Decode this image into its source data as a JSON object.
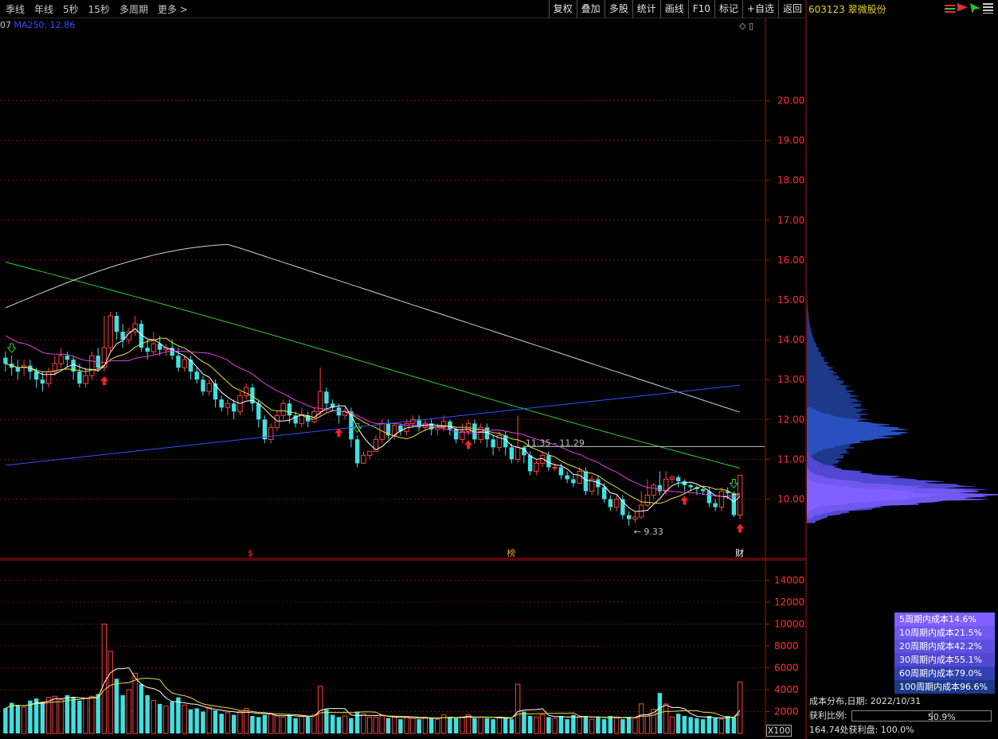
{
  "toolbar": {
    "left_items": [
      "季线",
      "年线",
      "5秒",
      "15秒",
      "多周期",
      "更多 >"
    ],
    "right_items": [
      "复权",
      "叠加",
      "多股",
      "统计",
      "画线",
      "F10",
      "标记",
      "+自选",
      "返回"
    ]
  },
  "stock": {
    "code_name": "603123 翠微股份"
  },
  "ma_label": {
    "prefix": "07",
    "text": "MA250: 12.86"
  },
  "corner_icons": "◇ ▯",
  "chart_data": [
    {
      "type": "candlestick",
      "title": "",
      "ylim": [
        9.0,
        21.2
      ],
      "y_ticks": [
        10.0,
        11.0,
        12.0,
        13.0,
        14.0,
        15.0,
        16.0,
        17.0,
        18.0,
        19.0,
        20.0
      ],
      "y_tick_labels": [
        "10.00",
        "11.00",
        "12.00",
        "13.00",
        "14.00",
        "15.00",
        "16.00",
        "17.00",
        "18.00",
        "19.00",
        "20.00"
      ],
      "grid": true,
      "annotations": [
        {
          "text": "11.35 - 11.29",
          "value": 11.32
        },
        {
          "text": "9.33",
          "value": 9.33
        }
      ],
      "markers": [
        {
          "text": "$",
          "color": "#ff3030"
        },
        {
          "text": "榜",
          "color": "#e0a020"
        },
        {
          "text": "财",
          "color": "#ffffff"
        }
      ],
      "candles": [
        [
          13.55,
          13.4,
          13.7,
          13.2
        ],
        [
          13.4,
          13.3,
          13.6,
          13.1
        ],
        [
          13.3,
          13.2,
          13.5,
          13.0
        ],
        [
          13.3,
          13.35,
          13.5,
          13.1
        ],
        [
          13.35,
          13.2,
          13.5,
          13.0
        ],
        [
          13.2,
          13.0,
          13.3,
          12.8
        ],
        [
          13.0,
          12.9,
          13.2,
          12.7
        ],
        [
          12.9,
          13.2,
          13.3,
          12.8
        ],
        [
          13.2,
          13.4,
          13.6,
          13.1
        ],
        [
          13.4,
          13.6,
          13.8,
          13.3
        ],
        [
          13.6,
          13.5,
          13.7,
          13.3
        ],
        [
          13.5,
          13.2,
          13.6,
          13.0
        ],
        [
          13.2,
          12.9,
          13.4,
          12.8
        ],
        [
          12.9,
          13.1,
          13.3,
          12.8
        ],
        [
          13.1,
          13.6,
          13.7,
          13.0
        ],
        [
          13.6,
          13.3,
          13.8,
          13.2
        ],
        [
          13.3,
          13.8,
          14.6,
          13.2
        ],
        [
          13.8,
          14.6,
          14.7,
          13.7
        ],
        [
          14.6,
          14.2,
          14.7,
          14.0
        ],
        [
          14.2,
          14.0,
          14.4,
          13.8
        ],
        [
          14.0,
          14.2,
          14.3,
          13.9
        ],
        [
          14.2,
          14.4,
          14.6,
          14.1
        ],
        [
          14.4,
          13.8,
          14.5,
          13.7
        ],
        [
          13.8,
          13.7,
          14.0,
          13.5
        ],
        [
          13.7,
          13.9,
          14.2,
          13.6
        ],
        [
          13.9,
          13.75,
          14.1,
          13.6
        ],
        [
          13.75,
          13.8,
          13.9,
          13.6
        ],
        [
          13.8,
          13.6,
          14.0,
          13.5
        ],
        [
          13.6,
          13.3,
          13.8,
          13.2
        ],
        [
          13.3,
          13.5,
          13.6,
          13.2
        ],
        [
          13.5,
          13.2,
          13.6,
          13.0
        ],
        [
          13.2,
          13.0,
          13.3,
          12.9
        ],
        [
          13.0,
          12.7,
          13.1,
          12.6
        ],
        [
          12.7,
          12.9,
          13.0,
          12.6
        ],
        [
          12.9,
          12.5,
          13.0,
          12.3
        ],
        [
          12.5,
          12.3,
          12.6,
          12.2
        ],
        [
          12.3,
          12.4,
          12.5,
          12.1
        ],
        [
          12.4,
          12.2,
          12.5,
          12.0
        ],
        [
          12.2,
          12.6,
          12.7,
          12.1
        ],
        [
          12.6,
          12.8,
          12.9,
          12.5
        ],
        [
          12.8,
          12.4,
          12.9,
          12.2
        ],
        [
          12.4,
          12.0,
          12.5,
          11.8
        ],
        [
          12.0,
          11.5,
          12.1,
          11.4
        ],
        [
          11.5,
          11.8,
          11.9,
          11.4
        ],
        [
          11.8,
          12.1,
          12.2,
          11.7
        ],
        [
          12.1,
          12.4,
          12.5,
          12.0
        ],
        [
          12.4,
          12.1,
          12.5,
          11.9
        ],
        [
          12.1,
          11.9,
          12.2,
          11.8
        ],
        [
          11.9,
          12.1,
          12.3,
          11.8
        ],
        [
          12.1,
          11.95,
          12.2,
          11.8
        ],
        [
          11.95,
          12.2,
          12.3,
          11.9
        ],
        [
          12.2,
          12.7,
          13.3,
          12.1
        ],
        [
          12.7,
          12.4,
          12.8,
          12.2
        ],
        [
          12.4,
          12.3,
          12.5,
          12.2
        ],
        [
          12.3,
          12.1,
          12.4,
          11.9
        ],
        [
          12.1,
          12.2,
          12.3,
          12.0
        ],
        [
          12.2,
          11.5,
          12.3,
          11.3
        ],
        [
          11.5,
          10.9,
          11.6,
          10.8
        ],
        [
          10.9,
          11.1,
          11.2,
          10.9
        ],
        [
          11.1,
          11.2,
          11.2,
          11.0
        ],
        [
          11.2,
          11.5,
          11.6,
          11.2
        ],
        [
          11.5,
          11.9,
          12.0,
          11.4
        ],
        [
          11.9,
          11.6,
          12.0,
          11.5
        ],
        [
          11.6,
          11.85,
          11.9,
          11.5
        ],
        [
          11.85,
          11.7,
          11.9,
          11.6
        ],
        [
          11.7,
          11.9,
          12.0,
          11.6
        ],
        [
          11.9,
          12.0,
          12.1,
          11.8
        ],
        [
          12.0,
          11.8,
          12.1,
          11.7
        ],
        [
          11.8,
          11.9,
          12.0,
          11.7
        ],
        [
          11.9,
          11.75,
          12.0,
          11.6
        ],
        [
          11.75,
          11.8,
          11.9,
          11.6
        ],
        [
          11.8,
          11.95,
          12.1,
          11.7
        ],
        [
          11.95,
          11.75,
          12.0,
          11.6
        ],
        [
          11.75,
          11.5,
          11.8,
          11.4
        ],
        [
          11.5,
          11.7,
          11.9,
          11.4
        ],
        [
          11.7,
          11.9,
          12.0,
          11.6
        ],
        [
          11.9,
          11.5,
          12.0,
          11.4
        ],
        [
          11.5,
          11.8,
          11.9,
          11.4
        ],
        [
          11.8,
          11.5,
          11.9,
          11.3
        ],
        [
          11.5,
          11.3,
          11.6,
          11.1
        ],
        [
          11.3,
          11.6,
          11.7,
          11.2
        ],
        [
          11.6,
          11.3,
          11.7,
          11.1
        ],
        [
          11.3,
          11.0,
          11.4,
          10.9
        ],
        [
          11.0,
          11.3,
          12.1,
          10.9
        ],
        [
          11.3,
          11.1,
          11.35,
          10.9
        ],
        [
          11.1,
          10.7,
          11.2,
          10.6
        ],
        [
          10.7,
          10.9,
          11.0,
          10.6
        ],
        [
          10.9,
          11.1,
          11.2,
          10.8
        ],
        [
          11.1,
          10.8,
          11.2,
          10.7
        ],
        [
          10.8,
          10.8,
          10.9,
          10.7
        ],
        [
          10.8,
          10.6,
          10.9,
          10.5
        ],
        [
          10.6,
          10.5,
          10.7,
          10.4
        ],
        [
          10.5,
          10.4,
          10.6,
          10.3
        ],
        [
          10.4,
          10.7,
          10.8,
          10.4
        ],
        [
          10.7,
          10.2,
          10.8,
          10.1
        ],
        [
          10.2,
          10.5,
          10.6,
          10.1
        ],
        [
          10.5,
          10.3,
          10.6,
          10.1
        ],
        [
          10.3,
          10.0,
          10.4,
          9.9
        ],
        [
          10.0,
          9.8,
          10.1,
          9.7
        ],
        [
          9.8,
          10.0,
          10.1,
          9.7
        ],
        [
          10.0,
          9.6,
          10.1,
          9.5
        ],
        [
          9.6,
          9.5,
          9.7,
          9.33
        ],
        [
          9.5,
          9.55,
          9.7,
          9.4
        ],
        [
          9.55,
          9.85,
          10.2,
          9.5
        ],
        [
          9.85,
          10.1,
          10.5,
          9.8
        ],
        [
          10.1,
          10.35,
          10.4,
          10.0
        ],
        [
          10.35,
          10.2,
          10.7,
          10.1
        ],
        [
          10.2,
          10.5,
          10.7,
          10.1
        ],
        [
          10.5,
          10.55,
          10.6,
          10.4
        ],
        [
          10.55,
          10.45,
          10.6,
          10.3
        ],
        [
          10.45,
          10.35,
          10.5,
          10.2
        ],
        [
          10.35,
          10.3,
          10.4,
          10.2
        ],
        [
          10.3,
          10.25,
          10.35,
          10.1
        ],
        [
          10.25,
          10.2,
          10.3,
          10.1
        ],
        [
          10.2,
          9.9,
          10.3,
          9.8
        ],
        [
          9.9,
          9.8,
          10.0,
          9.7
        ],
        [
          9.8,
          10.2,
          10.3,
          9.7
        ],
        [
          10.2,
          10.15,
          10.3,
          10.0
        ],
        [
          10.15,
          9.6,
          10.2,
          9.55
        ],
        [
          9.6,
          10.6,
          10.6,
          9.5
        ]
      ],
      "ma_lines": [
        {
          "name": "MA5",
          "color": "#ffffff"
        },
        {
          "name": "MA10",
          "color": "#e8e040"
        },
        {
          "name": "MA20",
          "color": "#e040e0"
        },
        {
          "name": "MA60",
          "color": "#30d030"
        },
        {
          "name": "MA120",
          "color": "#d0d0d0"
        },
        {
          "name": "MA250",
          "color": "#3050ff"
        }
      ]
    },
    {
      "type": "bar",
      "title": "volume",
      "ylim": [
        0,
        15000
      ],
      "y_ticks": [
        2000,
        4000,
        6000,
        8000,
        10000,
        12000,
        14000
      ],
      "y_tick_labels": [
        "2000",
        "4000",
        "6000",
        "8000",
        "10000",
        "12000",
        "14000"
      ],
      "unit_label": "X100",
      "values": [
        2300,
        2800,
        2600,
        2400,
        3000,
        3200,
        2900,
        3300,
        3400,
        3100,
        3500,
        3300,
        3000,
        3200,
        3400,
        3600,
        10000,
        7500,
        5000,
        3500,
        4000,
        5500,
        4500,
        3500,
        3000,
        2700,
        2500,
        2900,
        3300,
        2600,
        2200,
        2300,
        2000,
        2400,
        2100,
        1800,
        1900,
        1700,
        2000,
        2300,
        1600,
        1500,
        1700,
        1800,
        1600,
        1500,
        1700,
        1400,
        1600,
        1500,
        1700,
        4300,
        2200,
        1700,
        1500,
        1600,
        1400,
        2000,
        1800,
        1500,
        1500,
        1600,
        1400,
        1500,
        1300,
        1500,
        1400,
        1300,
        1500,
        1400,
        1300,
        1700,
        1500,
        1400,
        1500,
        1700,
        1400,
        1500,
        1400,
        1300,
        1500,
        1400,
        1300,
        4500,
        2000,
        1600,
        1500,
        1700,
        1500,
        1400,
        1600,
        1300,
        1700,
        1500,
        1600,
        1300,
        1500,
        1300,
        1600,
        1500,
        1300,
        1500,
        1400,
        2700,
        1700,
        2200,
        3700,
        2700,
        1500,
        1800,
        1600,
        1500,
        1400,
        1300,
        1600,
        1400,
        1300,
        1600,
        1500,
        4700
      ],
      "series": [
        {
          "name": "VMA5",
          "color": "#ffffff"
        },
        {
          "name": "VMA10",
          "color": "#e8e040"
        }
      ]
    },
    {
      "type": "profile",
      "title": "成本分布",
      "legend": [
        {
          "text": "5周期内成本14.6%",
          "color": "#8060ff"
        },
        {
          "text": "10周期内成本21.5%",
          "color": "#7058f0"
        },
        {
          "text": "20周期内成本42.2%",
          "color": "#6050e0"
        },
        {
          "text": "30周期内成本55.1%",
          "color": "#5048d0"
        },
        {
          "text": "60周期内成本79.0%",
          "color": "#3040b0"
        },
        {
          "text": "100周期内成本96.6%",
          "color": "#1d3a8a"
        }
      ]
    }
  ],
  "cost_info": {
    "date_line": "成本分布,日期: 2022/10/31",
    "profit_label": "获利比例:",
    "profit_value": "50.9%",
    "profit_line": "164.74处获利盘: 100.0%"
  },
  "colors": {
    "up": "#ff4040",
    "down": "#40e0e0",
    "grid": "#6a1010",
    "axis": "#b01010",
    "tick": "#ff3030"
  }
}
